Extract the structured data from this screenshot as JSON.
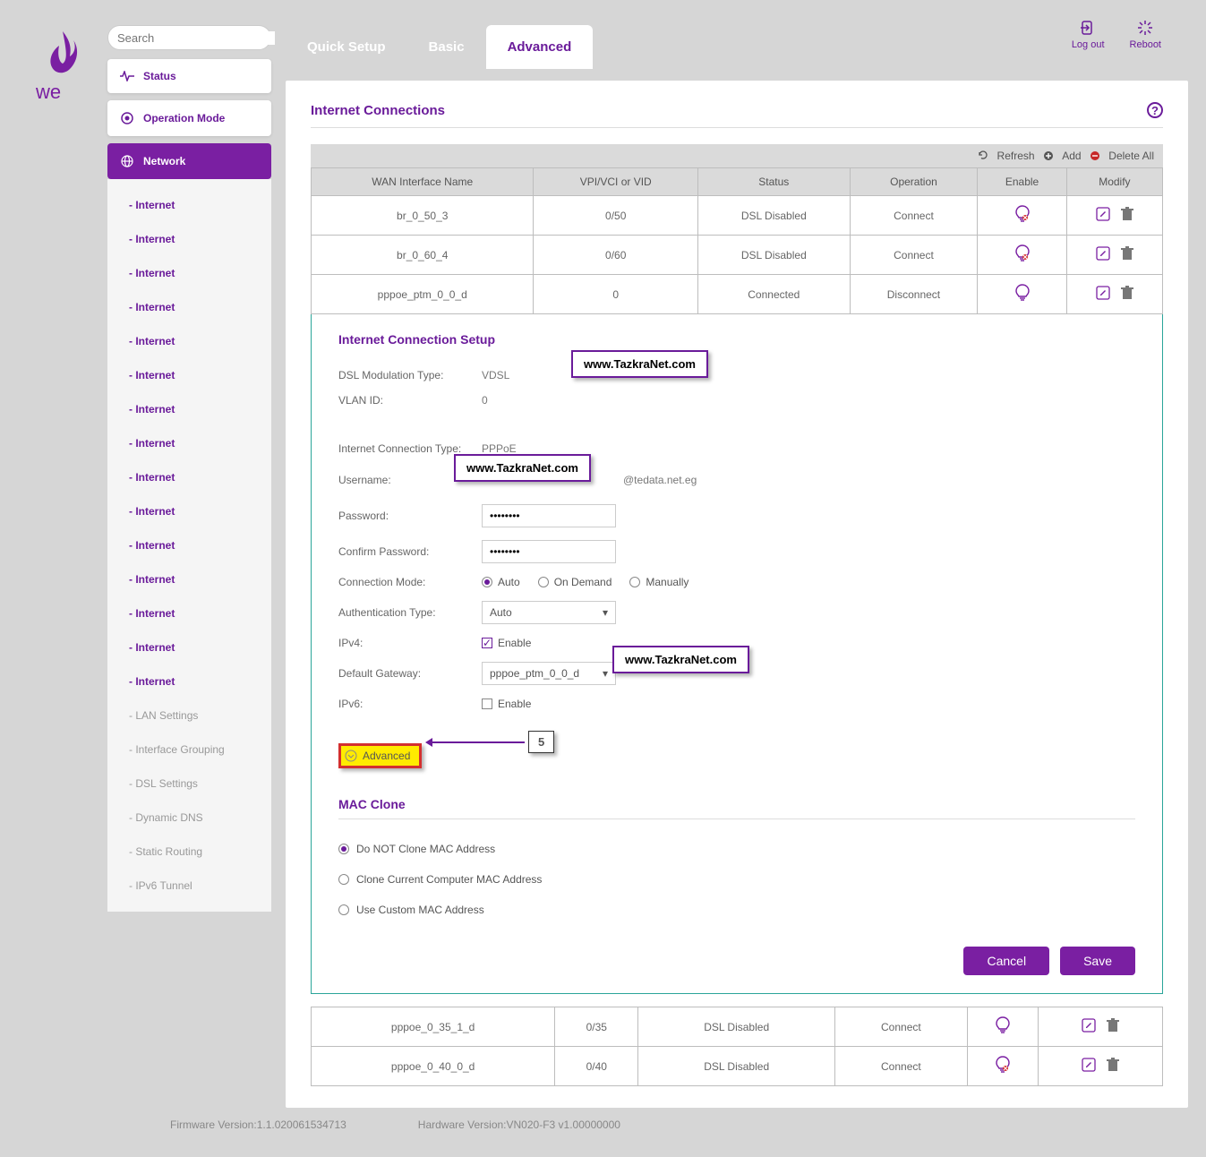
{
  "search": {
    "placeholder": "Search"
  },
  "nav": {
    "status": "Status",
    "operation_mode": "Operation Mode",
    "network": "Network"
  },
  "subnav": {
    "internet": "- Internet",
    "lan": "- LAN Settings",
    "ifg": "- Interface Grouping",
    "dsl": "- DSL Settings",
    "ddns": "- Dynamic DNS",
    "static": "- Static Routing",
    "ipv6t": "- IPv6 Tunnel"
  },
  "tabs": {
    "quick": "Quick Setup",
    "basic": "Basic",
    "advanced": "Advanced"
  },
  "header_actions": {
    "logout": "Log out",
    "reboot": "Reboot"
  },
  "panel": {
    "title": "Internet Connections"
  },
  "actions": {
    "refresh": "Refresh",
    "add": "Add",
    "delete_all": "Delete All"
  },
  "thead": {
    "wan": "WAN Interface Name",
    "vpi": "VPI/VCI or VID",
    "status": "Status",
    "op": "Operation",
    "enable": "Enable",
    "modify": "Modify"
  },
  "rows": [
    {
      "name": "br_0_50_3",
      "vpi": "0/50",
      "status": "DSL Disabled",
      "op": "Connect",
      "op_active": false,
      "bulb_off": true
    },
    {
      "name": "br_0_60_4",
      "vpi": "0/60",
      "status": "DSL Disabled",
      "op": "Connect",
      "op_active": false,
      "bulb_off": true
    },
    {
      "name": "pppoe_ptm_0_0_d",
      "vpi": "0",
      "status": "Connected",
      "op": "Disconnect",
      "op_active": true,
      "bulb_off": false
    }
  ],
  "rows2": [
    {
      "name": "pppoe_0_35_1_d",
      "vpi": "0/35",
      "status": "DSL Disabled",
      "op": "Connect",
      "op_active": false,
      "bulb_off": false
    },
    {
      "name": "pppoe_0_40_0_d",
      "vpi": "0/40",
      "status": "DSL Disabled",
      "op": "Connect",
      "op_active": false,
      "bulb_off": true
    }
  ],
  "setup": {
    "title": "Internet Connection Setup",
    "dsl_mod_l": "DSL Modulation Type:",
    "dsl_mod_v": "VDSL",
    "vlan_l": "VLAN ID:",
    "vlan_v": "0",
    "conn_type_l": "Internet Connection Type:",
    "conn_type_v": "PPPoE",
    "user_l": "Username:",
    "user_suffix": "@tedata.net.eg",
    "pass_l": "Password:",
    "pass_v": "••••••••",
    "cpass_l": "Confirm Password:",
    "cpass_v": "••••••••",
    "cmode_l": "Connection Mode:",
    "cmode_opts": {
      "auto": "Auto",
      "ondemand": "On Demand",
      "manual": "Manually"
    },
    "auth_l": "Authentication Type:",
    "auth_v": "Auto",
    "ipv4_l": "IPv4:",
    "enable": "Enable",
    "gw_l": "Default Gateway:",
    "gw_v": "pppoe_ptm_0_0_d",
    "ipv6_l": "IPv6:",
    "advanced_toggle": "Advanced",
    "mac_title": "MAC Clone",
    "mac1": "Do NOT Clone MAC Address",
    "mac2": "Clone Current Computer MAC Address",
    "mac3": "Use Custom MAC Address",
    "cancel": "Cancel",
    "save": "Save"
  },
  "watermark": {
    "text": "www.TazkraNet.com"
  },
  "annot": {
    "five": "5"
  },
  "footer": {
    "fw": "Firmware Version:1.1.020061534713",
    "hw": "Hardware Version:VN020-F3 v1.00000000"
  }
}
